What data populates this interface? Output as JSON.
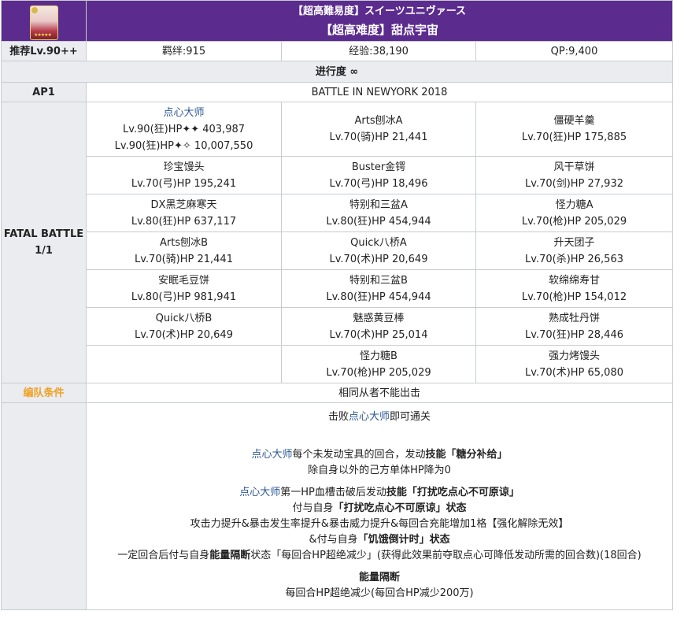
{
  "header": {
    "title_jp": "【超高難易度】スイーツユニヴァース",
    "title_cn": "【超高难度】甜点宇宙"
  },
  "info": {
    "recommend": "推荐Lv.90++",
    "bond": "羁绊:915",
    "exp": "经验:38,190",
    "qp": "QP:9,400"
  },
  "progress": "进行度 ∞",
  "ap": {
    "label": "AP1",
    "value": "BATTLE IN NEWYORK 2018"
  },
  "battle": {
    "label1": "FATAL BATTLE",
    "label2": "1/1"
  },
  "enemies": [
    {
      "name": "点心大师",
      "lines": [
        "Lv.90(狂)HP✦✦ 403,987",
        "Lv.90(狂)HP✦✧ 10,007,550"
      ],
      "boss": true
    },
    {
      "name": "Arts刨冰A",
      "lines": [
        "Lv.70(骑)HP 21,441"
      ]
    },
    {
      "name": "僵硬羊羹",
      "lines": [
        "Lv.70(狂)HP 175,885"
      ]
    },
    {
      "name": "珍宝馒头",
      "lines": [
        "Lv.70(弓)HP 195,241"
      ]
    },
    {
      "name": "Buster金锷",
      "lines": [
        "Lv.70(弓)HP 18,496"
      ]
    },
    {
      "name": "风干草饼",
      "lines": [
        "Lv.70(剑)HP 27,932"
      ]
    },
    {
      "name": "DX黑芝麻寒天",
      "lines": [
        "Lv.80(狂)HP 637,117"
      ]
    },
    {
      "name": "特别和三盆A",
      "lines": [
        "Lv.80(狂)HP 454,944"
      ]
    },
    {
      "name": "怪力糖A",
      "lines": [
        "Lv.70(枪)HP 205,029"
      ]
    },
    {
      "name": "Arts刨冰B",
      "lines": [
        "Lv.70(骑)HP 21,441"
      ]
    },
    {
      "name": "Quick八桥A",
      "lines": [
        "Lv.70(术)HP 20,649"
      ]
    },
    {
      "name": "升天团子",
      "lines": [
        "Lv.70(杀)HP 26,563"
      ]
    },
    {
      "name": "安眠毛豆饼",
      "lines": [
        "Lv.80(弓)HP 981,941"
      ]
    },
    {
      "name": "特别和三盆B",
      "lines": [
        "Lv.80(狂)HP 454,944"
      ]
    },
    {
      "name": "软绵绵寿甘",
      "lines": [
        "Lv.70(枪)HP 154,012"
      ]
    },
    {
      "name": "Quick八桥B",
      "lines": [
        "Lv.70(术)HP 20,649"
      ]
    },
    {
      "name": "魅惑黄豆棒",
      "lines": [
        "Lv.70(术)HP 25,014"
      ]
    },
    {
      "name": "熟成牡丹饼",
      "lines": [
        "Lv.70(狂)HP 28,446"
      ]
    },
    {
      "name": "",
      "lines": []
    },
    {
      "name": "怪力糖B",
      "lines": [
        "Lv.70(枪)HP 205,029"
      ]
    },
    {
      "name": "强力烤馒头",
      "lines": [
        "Lv.70(术)HP 65,080"
      ]
    }
  ],
  "team": {
    "label": "编队条件",
    "value": "相同从者不能出击"
  },
  "desc": {
    "l1_pre": "击败",
    "l1_link": "点心大师",
    "l1_post": "即可通关",
    "l2_link": "点心大师",
    "l2_mid": "每个未发动宝具的回合，发动",
    "l2_bold": "技能「糖分补给」",
    "l3": "除自身以外的己方单体HP降为0",
    "l4_link": "点心大师",
    "l4_mid": "第一HP血槽击破后发动",
    "l4_bold": "技能「打扰吃点心不可原谅」",
    "l5_pre": "付与自身",
    "l5_bold": "「打扰吃点心不可原谅」状态",
    "l6": "攻击力提升&暴击发生率提升&暴击威力提升&每回合充能增加1格【强化解除无效】",
    "l7_pre": "&付与自身",
    "l7_bold": "「饥饿倒计时」状态",
    "l8_pre": "一定回合后付与自身",
    "l8_bold": "能量隔断",
    "l8_post": "状态「每回合HP超绝减少」(获得此效果前夺取点心可降低发动所需的回合数)(18回合)",
    "l9_bold": "能量隔断",
    "l10": "每回合HP超绝减少(每回合HP减少200万)"
  }
}
